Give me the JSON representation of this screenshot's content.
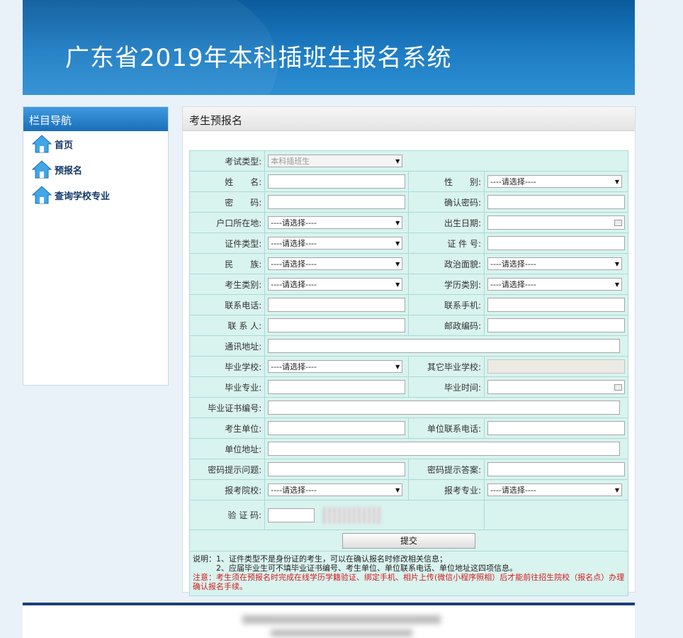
{
  "banner": {
    "title": "广东省2019年本科插班生报名系统"
  },
  "sidebar": {
    "header": "栏目导航",
    "items": [
      {
        "label": "首页",
        "icon": "house-icon"
      },
      {
        "label": "预报名",
        "icon": "house-icon"
      },
      {
        "label": "查询学校专业",
        "icon": "house-icon"
      }
    ]
  },
  "main": {
    "header": "考生预报名"
  },
  "form": {
    "exam_type_label": "考试类型:",
    "exam_type_value": "本科插班生",
    "name_label": "姓　　名:",
    "gender_label": "性　　别:",
    "gender_value": "----请选择----",
    "password_label": "密　　码:",
    "confirm_password_label": "确认密码:",
    "hukou_label": "户口所在地:",
    "hukou_value": "----请选择----",
    "birth_label": "出生日期:",
    "id_type_label": "证件类型:",
    "id_type_value": "----请选择----",
    "id_number_label": "证 件 号:",
    "ethnicity_label": "民　　族:",
    "ethnicity_value": "----请选择----",
    "political_label": "政治面貌:",
    "political_value": "----请选择----",
    "candidate_type_label": "考生类别:",
    "candidate_type_value": "----请选择----",
    "education_type_label": "学历类别:",
    "education_type_value": "----请选择----",
    "phone_label": "联系电话:",
    "mobile_label": "联系手机:",
    "contact_label": "联 系 人:",
    "postcode_label": "邮政编码:",
    "address_label": "通讯地址:",
    "grad_school_label": "毕业学校:",
    "grad_school_value": "----请选择----",
    "other_school_label": "其它毕业学校:",
    "major_label": "毕业专业:",
    "grad_time_label": "毕业时间:",
    "cert_no_label": "毕业证书编号:",
    "work_unit_label": "考生单位:",
    "unit_phone_label": "单位联系电话:",
    "unit_address_label": "单位地址:",
    "hint_question_label": "密码提示问题:",
    "hint_answer_label": "密码提示答案:",
    "apply_school_label": "报考院校:",
    "apply_school_value": "----请选择----",
    "apply_major_label": "报考专业:",
    "apply_major_value": "----请选择----",
    "captcha_label": "验 证 码:",
    "submit_label": "提交"
  },
  "notes": {
    "line1": "说明：1、证件类型不是身份证的考生，可以在确认报名时修改相关信息；",
    "line2": "　　　2、应届毕业生可不填毕业证书编号、考生单位、单位联系电话、单位地址这四项信息。",
    "warning": "注意：考生须在预报名时完成在线学历学籍验证、绑定手机、相片上传(微信小程序照相）后才能前往招生院校（报名点）办理确认报名手续。"
  }
}
